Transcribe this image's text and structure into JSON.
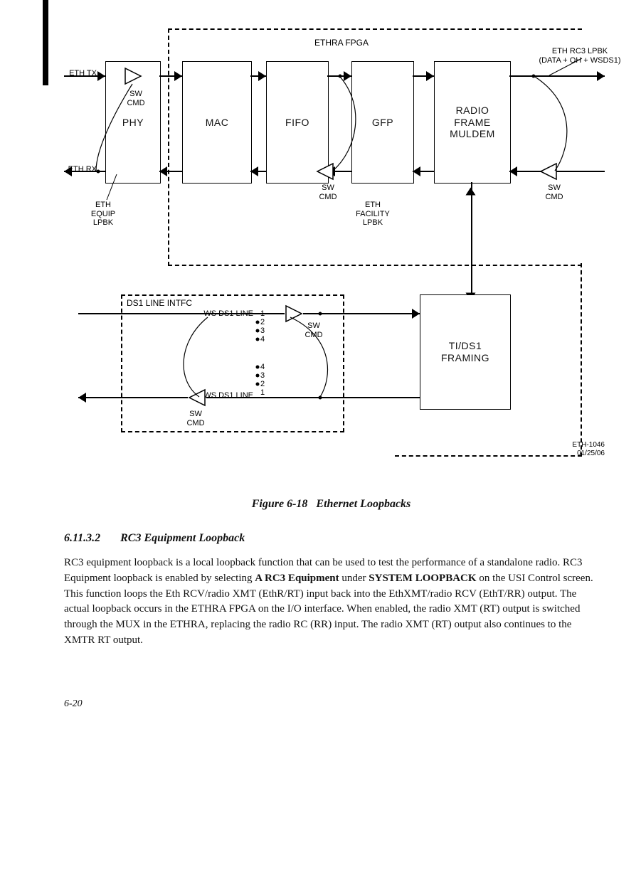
{
  "figure": {
    "fpga_label": "ETHRA FPGA",
    "blocks": {
      "phy": "PHY",
      "mac": "MAC",
      "fifo": "FIFO",
      "gfp": "GFP",
      "radio": "RADIO\nFRAME\nMULDEM",
      "tids1": "TI/DS1\nFRAMING"
    },
    "labels": {
      "eth_tx": "ETH TX",
      "eth_rx": "ETH RX",
      "eth_rc3": "ETH RC3 LPBK\n(DATA + OH + WSDS1)",
      "sw_cmd": "SW\nCMD",
      "eth_equip": "ETH\nEQUIP\nLPBK",
      "eth_facility": "ETH\nFACILITY\nLPBK",
      "ds1_intfc": "DS1 LINE  INTFC",
      "ws_ds1_top_prefix": "WS DS1 LINE",
      "ws_ds1_top_nums": [
        "1",
        "2",
        "3",
        "4"
      ],
      "ws_ds1_bot_prefix": "WS DS1 LINE",
      "ws_ds1_bot_nums": [
        "4",
        "3",
        "2",
        "1"
      ]
    },
    "doc_id": "ETH-1046",
    "doc_date": "01/25/06",
    "caption_label": "Figure 6-18",
    "caption_title": "Ethernet Loopbacks"
  },
  "section": {
    "number": "6.11.3.2",
    "title": "RC3 Equipment Loopback",
    "body_html": "RC3 equipment loopback is a local loopback function that can be used to test the performance of a standalone radio. RC3 Equipment loopback is enabled by selecting <b>A RC3 Equipment</b> under <b>SYSTEM LOOPBACK</b> on the USI Control screen. This function loops the Eth RCV/radio XMT (EthR/RT) input back into the EthXMT/radio RCV (EthT/RR) output. The actual loopback occurs in the ETHRA FPGA on the I/O interface. When enabled, the radio XMT (RT) output is switched through the MUX in the ETHRA, replacing the radio RC (RR) input. The radio XMT (RT) output also continues to the XMTR RT output."
  },
  "page_number": "6-20"
}
